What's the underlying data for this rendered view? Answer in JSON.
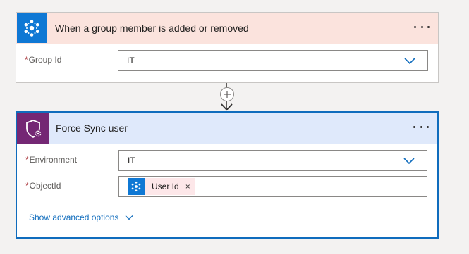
{
  "trigger": {
    "title": "When a group member is added or removed",
    "icon": "azure-ad-people-icon",
    "color": "#0f78d4",
    "fields": {
      "group_id": {
        "label": "Group Id",
        "required": "*",
        "value": "IT"
      }
    }
  },
  "action": {
    "title": "Force Sync user",
    "icon": "shield-gear-icon",
    "color": "#742774",
    "fields": {
      "environment": {
        "label": "Environment",
        "required": "*",
        "value": "IT"
      },
      "object_id": {
        "label": "ObjectId",
        "required": "*",
        "token": {
          "label": "User Id",
          "remove": "×",
          "icon": "azure-ad-people-icon"
        }
      }
    },
    "advanced_label": "Show advanced options"
  },
  "colors": {
    "accent": "#0f6cbd",
    "trigger_header": "#fbe3dd",
    "action_header": "#dfe9fb",
    "required": "#a4262c"
  }
}
